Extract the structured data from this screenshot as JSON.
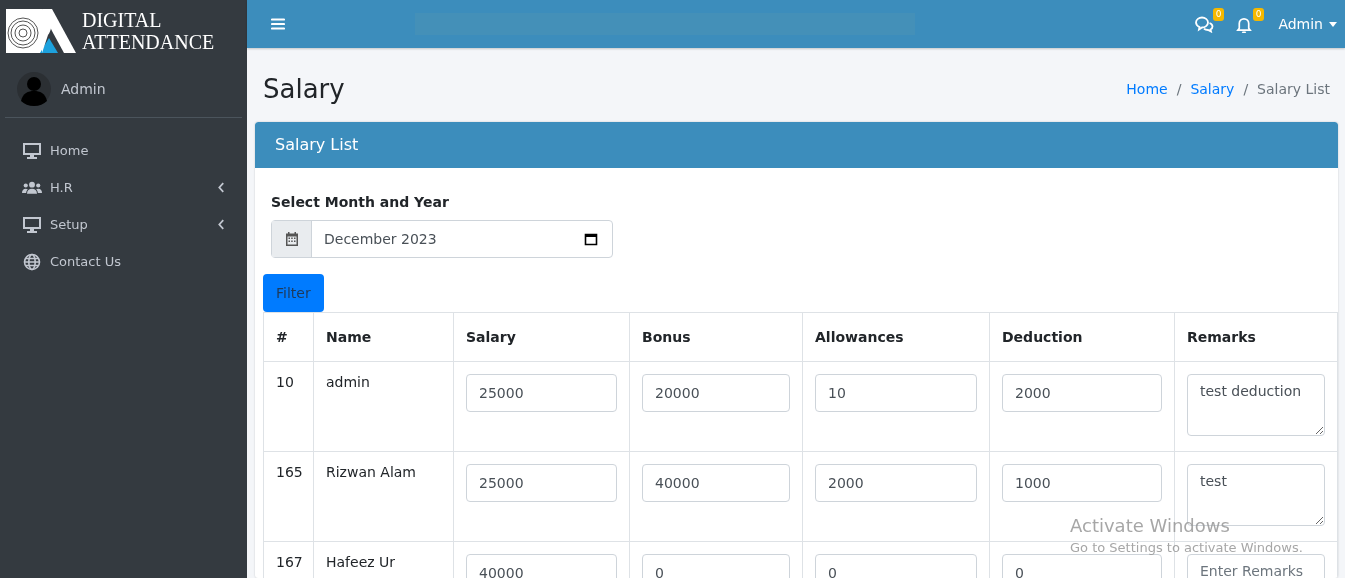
{
  "brand": {
    "line_1": "DIGITAL",
    "line_2": "ATTENDANCE"
  },
  "user": {
    "name": "Admin"
  },
  "sidebar": {
    "items": [
      {
        "label": "Home",
        "kind": "monitor",
        "has_submenu": false
      },
      {
        "label": "H.R",
        "kind": "users",
        "has_submenu": true
      },
      {
        "label": "Setup",
        "kind": "monitor",
        "has_submenu": true
      },
      {
        "label": "Contact Us",
        "kind": "globe",
        "has_submenu": false
      }
    ]
  },
  "topbar": {
    "messages_count": "0",
    "notifications_count": "0",
    "user_menu": "Admin"
  },
  "page": {
    "title": "Salary",
    "breadcrumb": [
      {
        "kind": "link",
        "label": "Home"
      },
      {
        "kind": "separator",
        "label": "/"
      },
      {
        "kind": "link",
        "label": "Salary"
      },
      {
        "kind": "separator",
        "label": "/"
      },
      {
        "kind": "current",
        "label": "Salary List"
      }
    ]
  },
  "card": {
    "title": "Salary List",
    "filter_label": "Select Month and Year",
    "month_value": "December 2023",
    "filter_button": "Filter"
  },
  "table": {
    "columns": [
      "#",
      "Name",
      "Salary",
      "Bonus",
      "Allowances",
      "Deduction",
      "Remarks"
    ],
    "rows": [
      {
        "id": "10",
        "name": "admin",
        "salary": "25000",
        "bonus": "20000",
        "allowances": "10",
        "deduction": "2000",
        "remarks": "test deduction"
      },
      {
        "id": "165",
        "name": "Rizwan Alam",
        "salary": "25000",
        "bonus": "40000",
        "allowances": "2000",
        "deduction": "1000",
        "remarks": "test"
      },
      {
        "id": "167",
        "name": "Hafeez Ur",
        "salary": "40000",
        "bonus": "0",
        "allowances": "0",
        "deduction": "0",
        "remarks_placeholder": "Enter Remarks"
      }
    ]
  },
  "os_notice": {
    "title": "Activate Windows",
    "text": "Go to Settings to activate Windows."
  }
}
